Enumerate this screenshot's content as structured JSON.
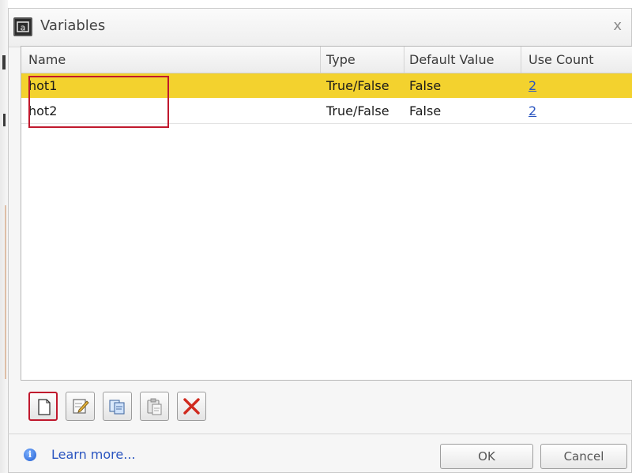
{
  "window": {
    "title": "Variables",
    "close_label": "x"
  },
  "grid": {
    "columns": [
      "Name",
      "Type",
      "Default Value",
      "Use Count"
    ],
    "rows": [
      {
        "name": "hot1",
        "type": "True/False",
        "default_value": "False",
        "use_count": "2",
        "selected": true
      },
      {
        "name": "hot2",
        "type": "True/False",
        "default_value": "False",
        "use_count": "2",
        "selected": false
      }
    ]
  },
  "toolbar": {
    "buttons": [
      {
        "icon": "new-document-icon"
      },
      {
        "icon": "edit-icon"
      },
      {
        "icon": "copy-icon"
      },
      {
        "icon": "paste-icon"
      },
      {
        "icon": "delete-icon"
      }
    ]
  },
  "footer": {
    "learn_more": "Learn more...",
    "ok_label": "OK",
    "cancel_label": "Cancel"
  },
  "colors": {
    "selection": "#f3d22e",
    "highlight_outline": "#c0182d",
    "link": "#2a55c0"
  }
}
